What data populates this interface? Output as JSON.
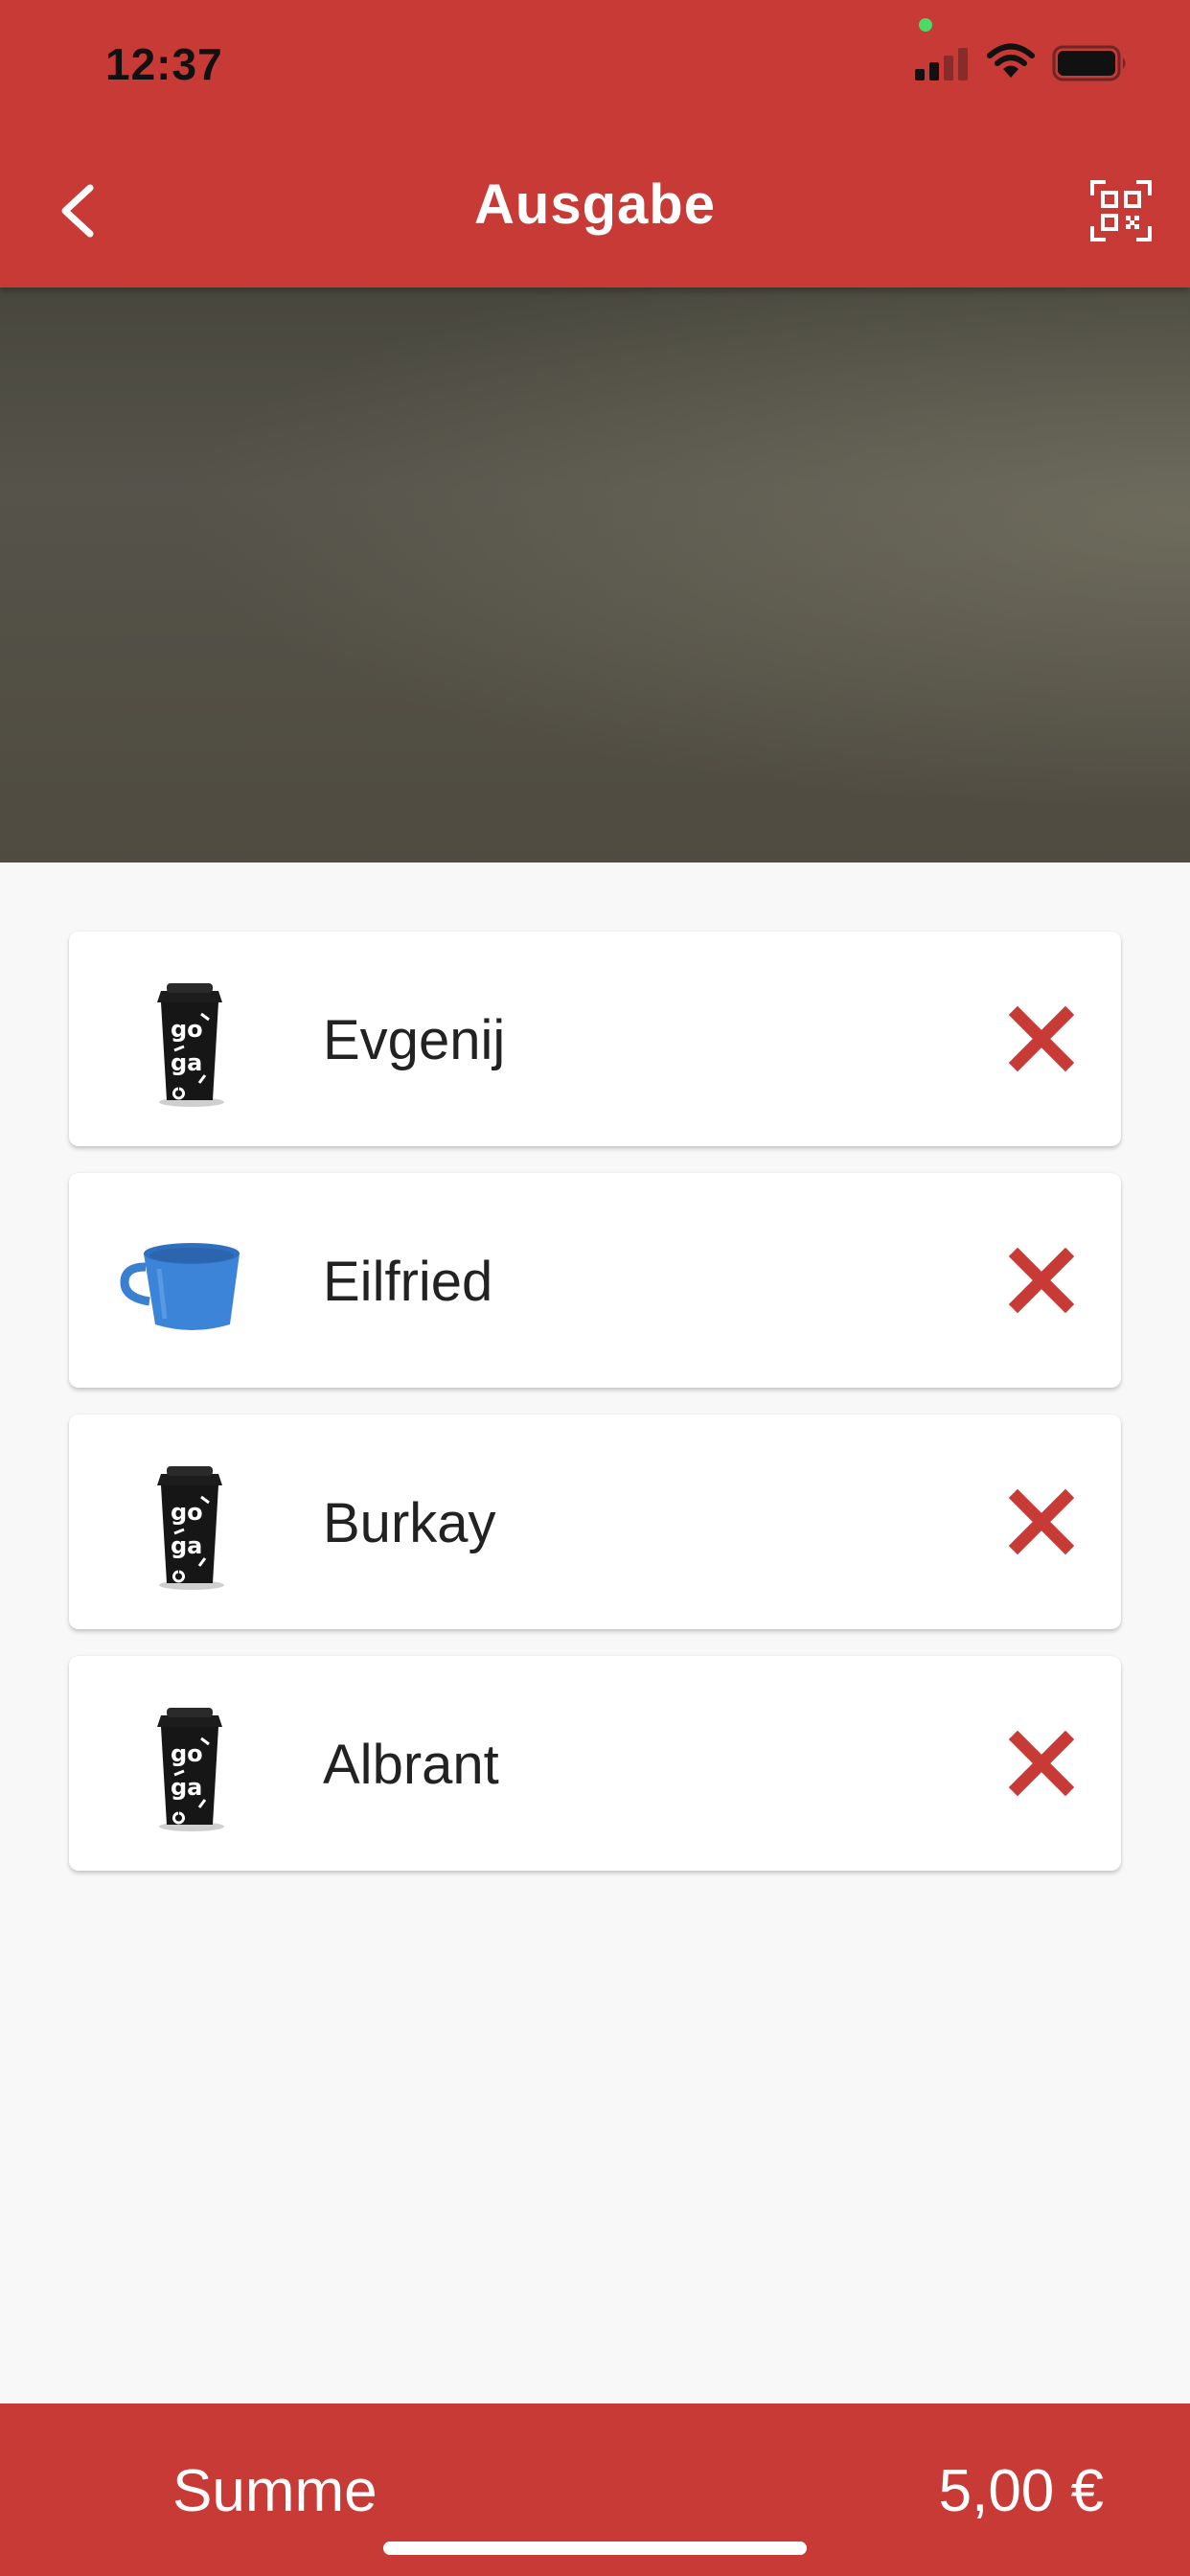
{
  "status_bar": {
    "time": "12:37"
  },
  "header": {
    "title": "Ausgabe",
    "back_icon": "chevron-left-icon",
    "scan_icon": "qr-code-icon"
  },
  "camera": {
    "description_icon": "camera-preview"
  },
  "items": [
    {
      "name": "Evgenij",
      "cup": "black-togo-cup-icon"
    },
    {
      "name": "Eilfried",
      "cup": "blue-mug-icon"
    },
    {
      "name": "Burkay",
      "cup": "black-togo-cup-icon"
    },
    {
      "name": "Albrant",
      "cup": "black-togo-cup-icon"
    }
  ],
  "footer": {
    "sum_label": "Summe",
    "sum_value": "5,00 €"
  },
  "colors": {
    "accent": "#c83a36",
    "background": "#f8f8f8",
    "mic_indicator": "#4cd964"
  }
}
